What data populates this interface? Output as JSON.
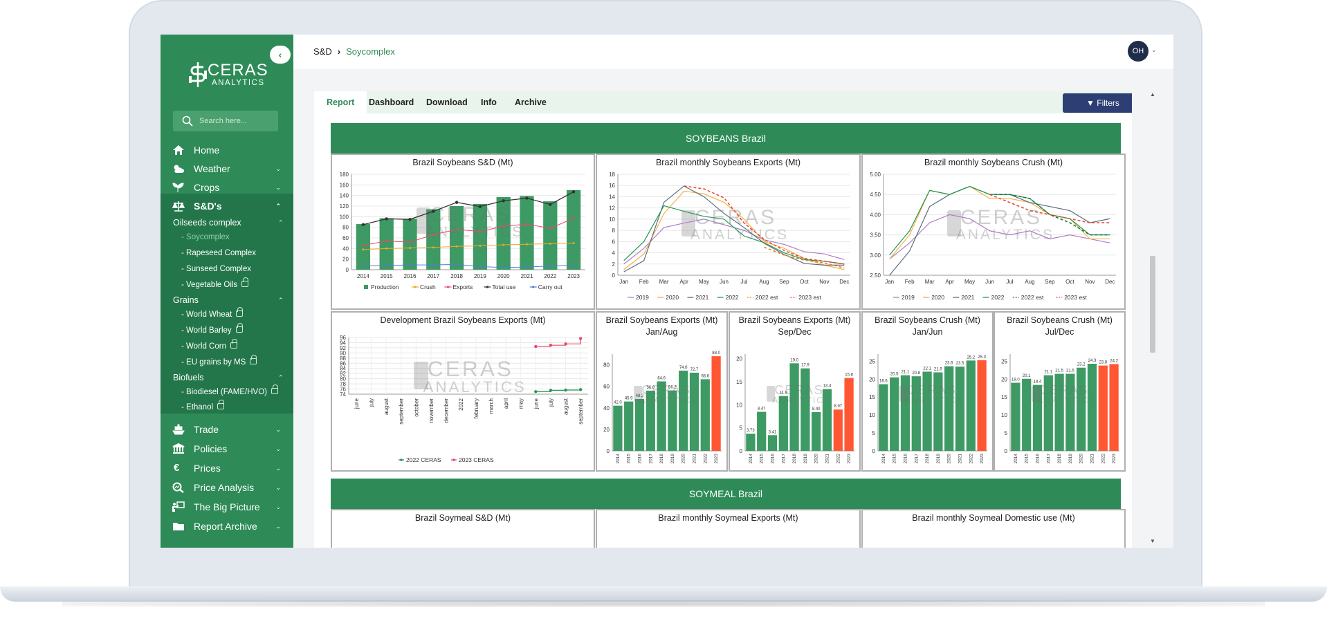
{
  "app": {
    "logo_line1": "CERAS",
    "logo_line2": "ANALYTICS",
    "watermark1": "CERAS",
    "watermark2": "ANALYTICS"
  },
  "sidebar": {
    "collapse_icon": "chevron-left-icon",
    "search_placeholder": "Search here...",
    "items": [
      {
        "label": "Home",
        "icon": "home-icon"
      },
      {
        "label": "Weather",
        "icon": "weather-icon"
      },
      {
        "label": "Crops",
        "icon": "sprout-icon"
      },
      {
        "label": "S&D's",
        "icon": "scale-icon"
      },
      {
        "label": "Trade",
        "icon": "ship-icon"
      },
      {
        "label": "Policies",
        "icon": "bank-icon"
      },
      {
        "label": "Prices",
        "icon": "euro-icon"
      },
      {
        "label": "Price Analysis",
        "icon": "magnify-chart-icon"
      },
      {
        "label": "The Big Picture",
        "icon": "presenter-icon"
      },
      {
        "label": "Report Archive",
        "icon": "folder-icon"
      }
    ],
    "groups": [
      {
        "label": "Oilseeds complex",
        "leaves": [
          "- Soycomplex",
          "- Rapeseed Complex",
          "- Sunseed Complex",
          "- Vegetable Oils"
        ]
      },
      {
        "label": "Grains",
        "leaves": [
          "- World Wheat",
          "- World Barley",
          "- World Corn",
          "- EU grains by MS"
        ]
      },
      {
        "label": "Biofuels",
        "leaves": [
          "- Biodiesel (FAME/HVO)",
          "- Ethanol"
        ]
      }
    ]
  },
  "header": {
    "crumb_root": "S&D",
    "crumb_current": "Soycomplex",
    "avatar": "OH"
  },
  "tabs": [
    "Report",
    "Dashboard",
    "Download",
    "Info",
    "Archive"
  ],
  "filters_label": "Filters",
  "sections": {
    "soybeans": "SOYBEANS Brazil",
    "soymeal": "SOYMEAL Brazil"
  },
  "colors": {
    "green": "#2e8b57",
    "bar_green": "#3e9a64",
    "orange_red": "#ff5733",
    "navy": "#2c3e74"
  },
  "panels": {
    "sd_title": "Brazil Soybeans S&D (Mt)",
    "exports_title": "Brazil monthly Soybeans Exports (Mt)",
    "crush_title": "Brazil monthly Soybeans Crush (Mt)",
    "dev_title": "Development Brazil Soybeans Exports (Mt)",
    "exp_ja_title1": "Brazil Soybeans Exports (Mt)",
    "exp_ja_title2": "Jan/Aug",
    "exp_sd_title1": "Brazil Soybeans Exports (Mt)",
    "exp_sd_title2": "Sep/Dec",
    "cr_jj_title1": "Brazil Soybeans Crush (Mt)",
    "cr_jj_title2": "Jan/Jun",
    "cr_jd_title1": "Brazil Soybeans Crush (Mt)",
    "cr_jd_title2": "Jul/Dec",
    "meal_sd_title": "Brazil Soymeal S&D (Mt)",
    "meal_exp_title": "Brazil monthly Soymeal Exports (Mt)",
    "meal_dom_title": "Brazil monthly Soymeal Domestic use (Mt)"
  },
  "chart_data": [
    {
      "type": "bar",
      "title": "Brazil Soybeans S&D (Mt)",
      "categories": [
        "2014",
        "2015",
        "2016",
        "2017",
        "2018",
        "2019",
        "2020",
        "2021",
        "2022",
        "2023"
      ],
      "ylim": [
        0,
        180
      ],
      "yticks": [
        0,
        20,
        40,
        60,
        80,
        100,
        120,
        140,
        160,
        180
      ],
      "series": [
        {
          "name": "Production",
          "kind": "bar",
          "color": "#3e9a64",
          "values": [
            86,
            97,
            96,
            114,
            120,
            124,
            137,
            139,
            129,
            150
          ]
        },
        {
          "name": "Crush",
          "kind": "line",
          "color": "#f5a623",
          "values": [
            38,
            40,
            41,
            42,
            44,
            45,
            47,
            48,
            49,
            50
          ]
        },
        {
          "name": "Exports",
          "kind": "line",
          "color": "#e8486b",
          "values": [
            46,
            54,
            52,
            66,
            76,
            72,
            82,
            86,
            78,
            97
          ]
        },
        {
          "name": "Total use",
          "kind": "line",
          "color": "#333333",
          "values": [
            85,
            96,
            95,
            110,
            127,
            119,
            130,
            135,
            123,
            147
          ]
        },
        {
          "name": "Carry out",
          "kind": "line",
          "color": "#4a7fd8",
          "values": [
            7,
            8,
            9,
            9,
            10,
            6,
            4,
            5,
            7,
            8
          ]
        }
      ]
    },
    {
      "type": "line",
      "title": "Brazil monthly Soybeans Exports (Mt)",
      "categories": [
        "Jan",
        "Feb",
        "Mar",
        "Apr",
        "May",
        "Jun",
        "Jul",
        "Aug",
        "Sep",
        "Oct",
        "Nov",
        "Dec"
      ],
      "ylim": [
        0,
        18
      ],
      "yticks": [
        0,
        2,
        4,
        6,
        8,
        10,
        12,
        14,
        16,
        18
      ],
      "series": [
        {
          "name": "2019",
          "color": "#b07cc6",
          "dash": false,
          "values": [
            2.0,
            4.8,
            8.5,
            9.3,
            10.0,
            9.0,
            8.0,
            6.3,
            5.5,
            4.2,
            3.8,
            2.8
          ]
        },
        {
          "name": "2020",
          "color": "#f5b041",
          "dash": false,
          "values": [
            1.0,
            3.8,
            11.0,
            15.0,
            14.5,
            13.0,
            10.0,
            6.0,
            4.8,
            3.0,
            1.8,
            1.0
          ]
        },
        {
          "name": "2021",
          "color": "#5d6d7e",
          "dash": false,
          "values": [
            0.6,
            2.6,
            13.0,
            15.9,
            14.0,
            11.0,
            8.5,
            5.7,
            3.7,
            2.1,
            1.8,
            1.8
          ]
        },
        {
          "name": "2022",
          "color": "#229954",
          "dash": false,
          "values": [
            2.6,
            6.0,
            12.4,
            11.4,
            10.5,
            10.0,
            7.0,
            5.8,
            4.0,
            2.8,
            2.5,
            2.0
          ]
        },
        {
          "name": "2022 est",
          "color": "#e67e22",
          "dash": true,
          "values": [
            null,
            null,
            null,
            null,
            null,
            null,
            null,
            5.0,
            3.6,
            2.7,
            2.2,
            1.3
          ]
        },
        {
          "name": "2023 est",
          "color": "#e74c3c",
          "dash": true,
          "values": [
            null,
            null,
            null,
            15.9,
            15.4,
            13.8,
            9.3,
            6.4,
            4.4,
            3.0,
            2.5,
            2.0
          ]
        }
      ]
    },
    {
      "type": "line",
      "title": "Brazil monthly Soybeans Crush (Mt)",
      "categories": [
        "Jan",
        "Feb",
        "Mar",
        "Apr",
        "May",
        "Jun",
        "Jul",
        "Aug",
        "Sep",
        "Oct",
        "Nov",
        "Dec"
      ],
      "ylim": [
        2.5,
        5.0
      ],
      "yticks": [
        2.5,
        3.0,
        3.5,
        4.0,
        4.5,
        5.0
      ],
      "series": [
        {
          "name": "2019",
          "color": "#b07cc6",
          "dash": false,
          "values": [
            2.9,
            3.3,
            3.8,
            4.0,
            3.9,
            3.6,
            3.5,
            3.6,
            3.4,
            3.5,
            3.4,
            3.3
          ]
        },
        {
          "name": "2020",
          "color": "#f5b041",
          "dash": false,
          "values": [
            2.9,
            3.5,
            4.6,
            4.5,
            4.7,
            4.4,
            4.4,
            4.3,
            4.0,
            3.9,
            3.4,
            3.4
          ]
        },
        {
          "name": "2021",
          "color": "#5d6d7e",
          "dash": false,
          "values": [
            2.5,
            3.1,
            4.2,
            4.5,
            4.7,
            4.5,
            4.5,
            4.3,
            4.2,
            4.1,
            3.8,
            3.9
          ]
        },
        {
          "name": "2022",
          "color": "#229954",
          "dash": false,
          "values": [
            3.0,
            3.6,
            4.6,
            4.5,
            4.7,
            4.5,
            4.5,
            4.4,
            4.0,
            3.9,
            3.5,
            3.5
          ]
        },
        {
          "name": "2022 est",
          "color": "#1e7a44",
          "dash": true,
          "values": [
            null,
            null,
            null,
            null,
            null,
            4.5,
            4.5,
            4.4,
            4.0,
            3.8,
            3.5,
            3.5
          ]
        },
        {
          "name": "2023 est",
          "color": "#e74c3c",
          "dash": true,
          "values": [
            null,
            null,
            null,
            null,
            null,
            4.5,
            4.3,
            4.1,
            4.0,
            3.9,
            3.8,
            3.8
          ]
        }
      ]
    },
    {
      "type": "line",
      "title": "Development Brazil Soybeans Exports (Mt)",
      "categories": [
        "june",
        "july",
        "august",
        "september",
        "october",
        "november",
        "december",
        "2022",
        "february",
        "march",
        "april",
        "may",
        "june",
        "july",
        "august",
        "september"
      ],
      "ylim": [
        74,
        96
      ],
      "yticks": [
        74,
        76,
        78,
        80,
        82,
        84,
        86,
        88,
        90,
        92,
        94,
        96
      ],
      "series": [
        {
          "name": "2022 CERAS",
          "color": "#229954",
          "values": [
            null,
            null,
            null,
            null,
            null,
            null,
            null,
            null,
            null,
            null,
            null,
            null,
            75.0,
            75.5,
            75.6,
            75.8
          ]
        },
        {
          "name": "2023 CERAS",
          "color": "#e8486b",
          "values": [
            null,
            null,
            null,
            null,
            null,
            null,
            null,
            null,
            null,
            null,
            null,
            null,
            92.5,
            93.0,
            93.5,
            95.6
          ]
        }
      ]
    },
    {
      "type": "bar",
      "title": "Brazil Soybeans Exports (Mt) Jan/Aug",
      "categories": [
        "2014",
        "2015",
        "2016",
        "2017",
        "2018",
        "2019",
        "2020",
        "2021",
        "2022",
        "2023"
      ],
      "ylim": [
        0,
        90
      ],
      "yticks": [
        0,
        20,
        40,
        60,
        80
      ],
      "values": [
        42.0,
        45.9,
        48.2,
        56.0,
        64.6,
        56.2,
        74.6,
        72.7,
        66.6,
        88.0
      ],
      "labels": [
        "42.0",
        "45.9",
        "48.2",
        "56.0",
        "64.6",
        "56.2",
        "74.6",
        "72.7",
        "66.6",
        "88.0"
      ],
      "highlight": [
        9
      ]
    },
    {
      "type": "bar",
      "title": "Brazil Soybeans Exports (Mt) Sep/Dec",
      "categories": [
        "2014",
        "2015",
        "2016",
        "2017",
        "2018",
        "2019",
        "2020",
        "2021",
        "2022",
        "2023"
      ],
      "ylim": [
        0,
        21
      ],
      "yticks": [
        0,
        5,
        10,
        15,
        20
      ],
      "values": [
        3.73,
        8.47,
        3.41,
        11.9,
        19.0,
        17.9,
        8.4,
        13.4,
        8.97,
        15.8
      ],
      "labels": [
        "3.73",
        "8.47",
        "3.41",
        "11.9",
        "19.0",
        "17.9",
        "8.40",
        "13.4",
        "8.97",
        "15.8"
      ],
      "highlight": [
        8,
        9
      ]
    },
    {
      "type": "bar",
      "title": "Brazil Soybeans Crush (Mt) Jan/Jun",
      "categories": [
        "2014",
        "2015",
        "2016",
        "2017",
        "2018",
        "2019",
        "2020",
        "2021",
        "2022",
        "2023"
      ],
      "ylim": [
        0,
        27
      ],
      "yticks": [
        0,
        5,
        10,
        15,
        20,
        25
      ],
      "values": [
        18.6,
        20.5,
        21.1,
        20.8,
        22.1,
        21.9,
        23.6,
        23.5,
        25.2,
        25.3
      ],
      "labels": [
        "18.6",
        "20.5",
        "21.1",
        "20.8",
        "22.1",
        "21.9",
        "23.6",
        "23.5",
        "25.2",
        "25.3"
      ],
      "highlight": [
        9
      ]
    },
    {
      "type": "bar",
      "title": "Brazil Soybeans Crush (Mt) Jul/Dec",
      "categories": [
        "2014",
        "2015",
        "2016",
        "2017",
        "2018",
        "2019",
        "2020",
        "2021",
        "2022",
        "2023"
      ],
      "ylim": [
        0,
        27
      ],
      "yticks": [
        0,
        5,
        10,
        15,
        20,
        25
      ],
      "values": [
        19.0,
        20.1,
        18.4,
        21.1,
        21.5,
        21.5,
        23.2,
        24.3,
        23.8,
        24.2
      ],
      "labels": [
        "19.0",
        "20.1",
        "18.4",
        "21.1",
        "21.5",
        "21.5",
        "23.2",
        "24.3",
        "23.8",
        "24.2"
      ],
      "highlight": [
        8,
        9
      ]
    }
  ]
}
